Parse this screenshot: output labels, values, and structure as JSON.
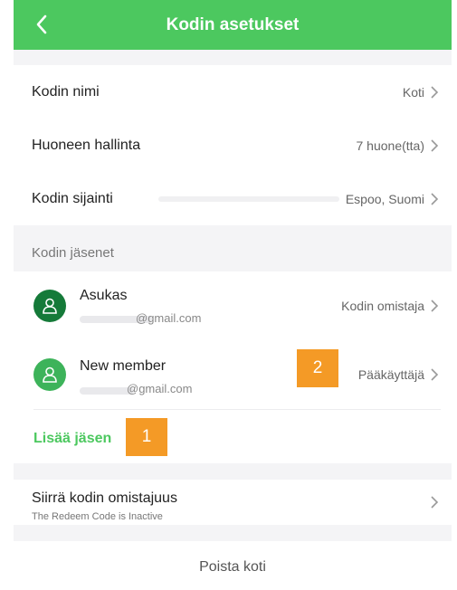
{
  "header": {
    "title": "Kodin asetukset"
  },
  "settings": {
    "home_name": {
      "label": "Kodin nimi",
      "value": "Koti"
    },
    "room_management": {
      "label": "Huoneen hallinta",
      "value": "7 huone(tta)"
    },
    "home_location": {
      "label": "Kodin sijainti",
      "value": "Espoo, Suomi"
    }
  },
  "members": {
    "section_title": "Kodin jäsenet",
    "list": [
      {
        "name": "Asukas",
        "email": "@gmail.com",
        "role": "Kodin omistaja"
      },
      {
        "name": "New member",
        "email": "@gmail.com",
        "role": "Pääkäyttäjä"
      }
    ],
    "add_label": "Lisää jäsen"
  },
  "transfer": {
    "label": "Siirrä kodin omistajuus",
    "subtitle": "The Redeem Code is Inactive"
  },
  "delete_label": "Poista koti",
  "annotations": {
    "badge1": "1",
    "badge2": "2"
  },
  "colors": {
    "accent": "#4cc85f",
    "badge": "#f49a26"
  }
}
